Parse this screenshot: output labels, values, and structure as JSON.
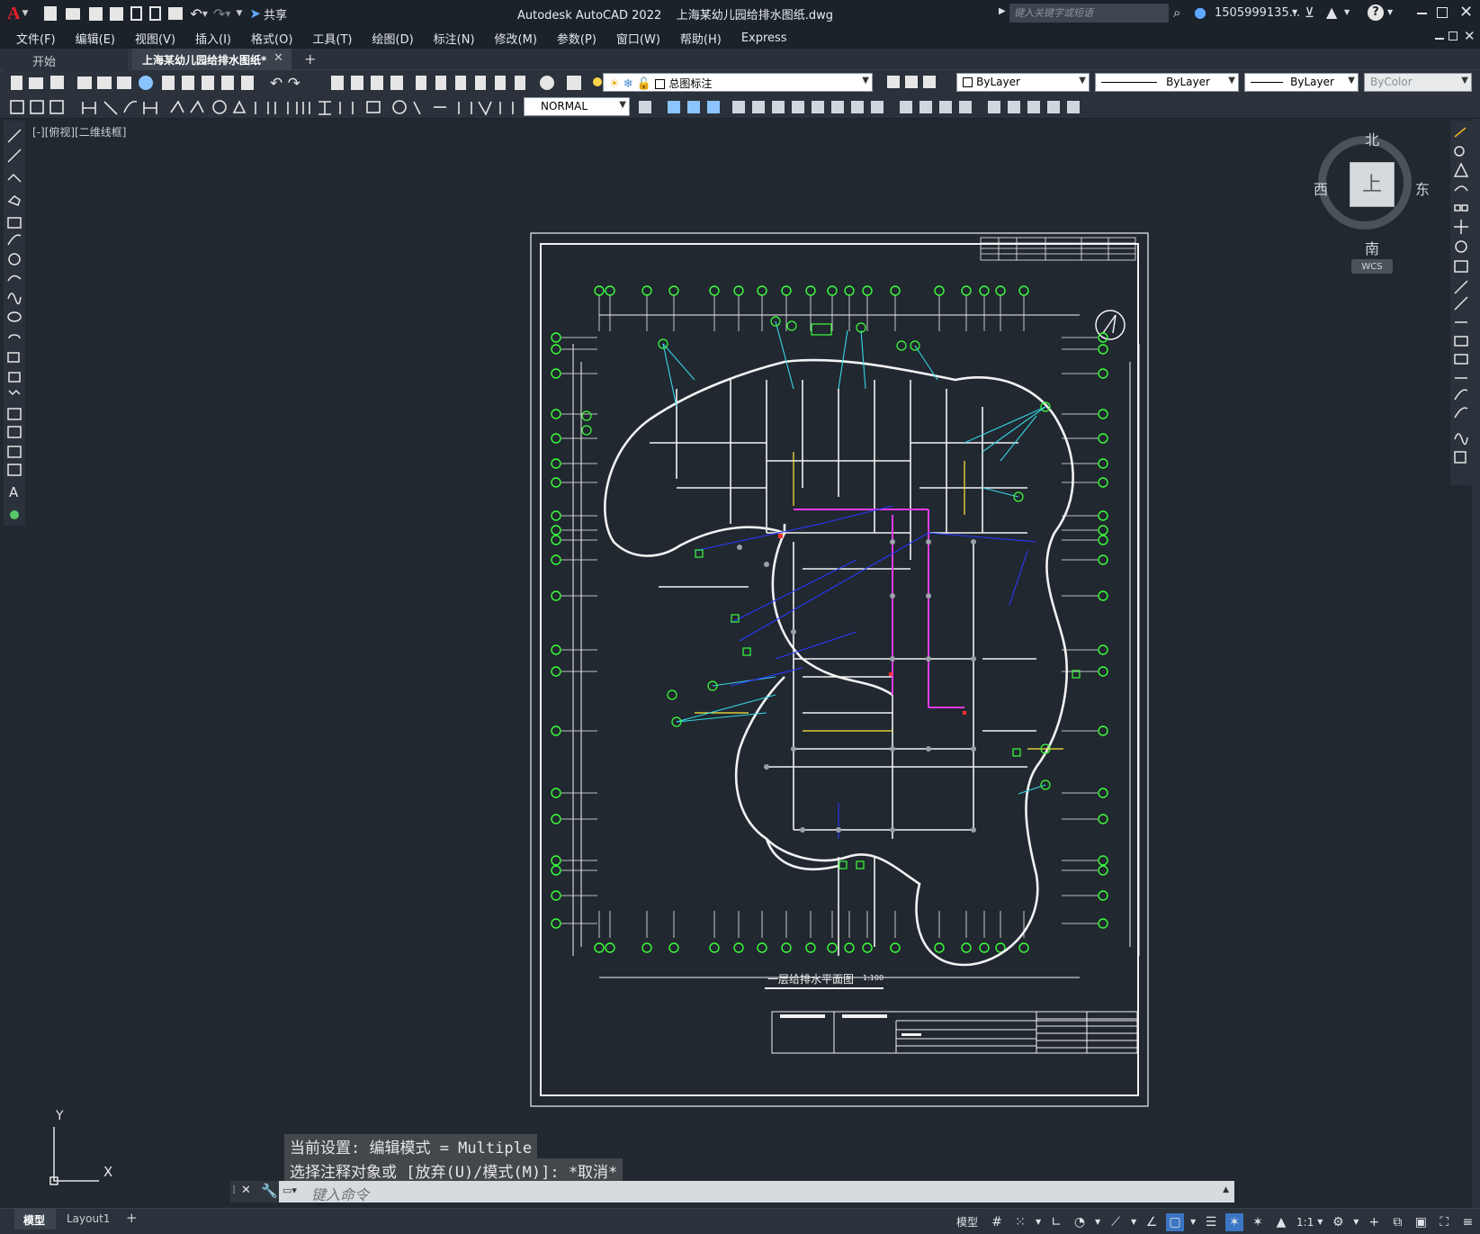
{
  "app": {
    "logo": "A",
    "window_title": "Autodesk AutoCAD 2022    上海某幼儿园给排水图纸.dwg",
    "share_label": "共享",
    "search_placeholder": "键入关键字或短语",
    "user": "1505999135...",
    "help": "?"
  },
  "menu": [
    "文件(F)",
    "编辑(E)",
    "视图(V)",
    "插入(I)",
    "格式(O)",
    "工具(T)",
    "绘图(D)",
    "标注(N)",
    "修改(M)",
    "参数(P)",
    "窗口(W)",
    "帮助(H)",
    "Express"
  ],
  "tabs": {
    "start": "开始",
    "active": "上海某幼儿园给排水图纸*",
    "add": "+"
  },
  "toolbar": {
    "layer": "总图标注",
    "color": "ByLayer",
    "linetype": "ByLayer",
    "lineweight": "ByLayer",
    "plotstyle": "ByColor",
    "dimstyle": "NORMAL"
  },
  "viewport": {
    "label": "[-][俯视][二维线框]",
    "compass_n": "北",
    "compass_s": "南",
    "compass_e": "东",
    "compass_w": "西",
    "cube_face": "上",
    "wcs": "WCS"
  },
  "drawing": {
    "title": "一层给排水平面图",
    "scale": "1:100"
  },
  "ucs": {
    "x": "X",
    "y": "Y"
  },
  "command": {
    "line1": "当前设置: 编辑模式 = Multiple",
    "line2": "选择注释对象或 [放弃(U)/模式(M)]: *取消*",
    "placeholder": "键入命令"
  },
  "layout_tabs": [
    "模型",
    "Layout1",
    "+"
  ],
  "status": {
    "model": "模型",
    "scale": "1:1"
  }
}
